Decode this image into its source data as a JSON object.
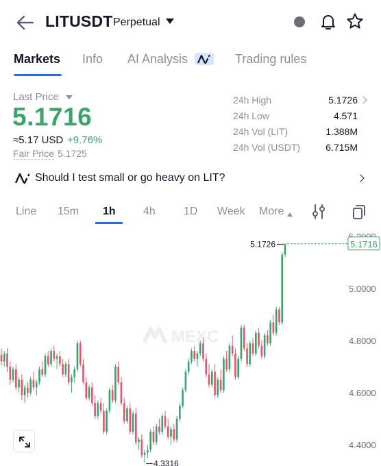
{
  "header": {
    "back_icon": "arrow-left-icon",
    "symbol": "LITUSDT",
    "contract_type": "Perpetual",
    "icons": [
      "status-dot-icon",
      "bell-icon",
      "star-icon"
    ]
  },
  "tabs": [
    {
      "label": "Markets",
      "active": true
    },
    {
      "label": "Info",
      "active": false
    },
    {
      "label": "AI Analysis",
      "active": false
    },
    {
      "label": "Trading rules",
      "active": false
    }
  ],
  "price": {
    "last_price_label": "Last Price",
    "last_price": "5.1716",
    "usd_value": "≈5.17 USD",
    "change": "+9.76%",
    "fair_price_label": "Fair Price",
    "fair_price": "5.1725"
  },
  "stats": [
    {
      "label": "24h High",
      "value": "5.1726"
    },
    {
      "label": "24h Low",
      "value": "4.571"
    },
    {
      "label": "24h Vol (LIT)",
      "value": "1.388M"
    },
    {
      "label": "24h Vol (USDT)",
      "value": "6.715M"
    }
  ],
  "ai_prompt": {
    "text": "Should I test small or go heavy on LIT?"
  },
  "intervals": [
    {
      "label": "Line",
      "active": false
    },
    {
      "label": "15m",
      "active": false
    },
    {
      "label": "1h",
      "active": true
    },
    {
      "label": "4h",
      "active": false
    },
    {
      "label": "1D",
      "active": false
    },
    {
      "label": "Week",
      "active": false
    },
    {
      "label": "More",
      "active": false
    }
  ],
  "colors": {
    "up": "#3aa56a",
    "down": "#e5566e",
    "accent": "#1f6fe0"
  },
  "chart_data": {
    "type": "candlestick",
    "y_ticks": [
      "5.2000",
      "5.0000",
      "4.8000",
      "4.6000",
      "4.4000"
    ],
    "ylim": [
      4.3,
      5.2
    ],
    "high_marker": "5.1726",
    "low_marker": "4.3316",
    "current_price_label": "5.1716",
    "watermark": "MEXC",
    "candles": [
      [
        4.745,
        4.77,
        4.705,
        4.72
      ],
      [
        4.72,
        4.76,
        4.7,
        4.75
      ],
      [
        4.75,
        4.77,
        4.68,
        4.7
      ],
      [
        4.7,
        4.72,
        4.63,
        4.65
      ],
      [
        4.65,
        4.7,
        4.64,
        4.69
      ],
      [
        4.69,
        4.71,
        4.61,
        4.62
      ],
      [
        4.62,
        4.66,
        4.6,
        4.65
      ],
      [
        4.65,
        4.67,
        4.57,
        4.59
      ],
      [
        4.59,
        4.63,
        4.56,
        4.62
      ],
      [
        4.62,
        4.64,
        4.58,
        4.6
      ],
      [
        4.6,
        4.66,
        4.59,
        4.65
      ],
      [
        4.65,
        4.68,
        4.61,
        4.62
      ],
      [
        4.62,
        4.65,
        4.59,
        4.64
      ],
      [
        4.64,
        4.7,
        4.63,
        4.69
      ],
      [
        4.69,
        4.72,
        4.66,
        4.67
      ],
      [
        4.67,
        4.75,
        4.66,
        4.74
      ],
      [
        4.74,
        4.76,
        4.7,
        4.71
      ],
      [
        4.71,
        4.77,
        4.7,
        4.76
      ],
      [
        4.76,
        4.78,
        4.72,
        4.73
      ],
      [
        4.73,
        4.75,
        4.69,
        4.74
      ],
      [
        4.74,
        4.76,
        4.7,
        4.71
      ],
      [
        4.71,
        4.73,
        4.66,
        4.67
      ],
      [
        4.67,
        4.72,
        4.66,
        4.71
      ],
      [
        4.71,
        4.73,
        4.63,
        4.64
      ],
      [
        4.64,
        4.67,
        4.6,
        4.66
      ],
      [
        4.66,
        4.7,
        4.64,
        4.69
      ],
      [
        4.69,
        4.8,
        4.68,
        4.79
      ],
      [
        4.79,
        4.8,
        4.7,
        4.71
      ],
      [
        4.71,
        4.73,
        4.63,
        4.64
      ],
      [
        4.64,
        4.66,
        4.57,
        4.58
      ],
      [
        4.58,
        4.63,
        4.57,
        4.62
      ],
      [
        4.62,
        4.64,
        4.55,
        4.56
      ],
      [
        4.56,
        4.59,
        4.5,
        4.51
      ],
      [
        4.51,
        4.57,
        4.5,
        4.56
      ],
      [
        4.56,
        4.58,
        4.52,
        4.53
      ],
      [
        4.53,
        4.56,
        4.44,
        4.45
      ],
      [
        4.45,
        4.54,
        4.44,
        4.53
      ],
      [
        4.53,
        4.62,
        4.52,
        4.61
      ],
      [
        4.61,
        4.63,
        4.56,
        4.57
      ],
      [
        4.57,
        4.71,
        4.56,
        4.7
      ],
      [
        4.7,
        4.72,
        4.63,
        4.64
      ],
      [
        4.64,
        4.66,
        4.55,
        4.56
      ],
      [
        4.56,
        4.58,
        4.48,
        4.49
      ],
      [
        4.49,
        4.55,
        4.48,
        4.54
      ],
      [
        4.54,
        4.56,
        4.44,
        4.45
      ],
      [
        4.45,
        4.53,
        4.44,
        4.52
      ],
      [
        4.52,
        4.54,
        4.4,
        4.41
      ],
      [
        4.41,
        4.43,
        4.38,
        4.42
      ],
      [
        4.42,
        4.44,
        4.35,
        4.36
      ],
      [
        4.36,
        4.38,
        4.33,
        4.37
      ],
      [
        4.37,
        4.4,
        4.35,
        4.38
      ],
      [
        4.38,
        4.46,
        4.37,
        4.45
      ],
      [
        4.45,
        4.47,
        4.4,
        4.41
      ],
      [
        4.41,
        4.48,
        4.4,
        4.47
      ],
      [
        4.47,
        4.5,
        4.44,
        4.45
      ],
      [
        4.45,
        4.52,
        4.44,
        4.51
      ],
      [
        4.51,
        4.53,
        4.46,
        4.47
      ],
      [
        4.47,
        4.5,
        4.42,
        4.43
      ],
      [
        4.43,
        4.47,
        4.4,
        4.46
      ],
      [
        4.46,
        4.48,
        4.41,
        4.42
      ],
      [
        4.42,
        4.51,
        4.41,
        4.5
      ],
      [
        4.5,
        4.56,
        4.49,
        4.55
      ],
      [
        4.55,
        4.62,
        4.54,
        4.61
      ],
      [
        4.61,
        4.69,
        4.6,
        4.68
      ],
      [
        4.68,
        4.73,
        4.67,
        4.72
      ],
      [
        4.72,
        4.77,
        4.71,
        4.76
      ],
      [
        4.76,
        4.78,
        4.72,
        4.73
      ],
      [
        4.73,
        4.76,
        4.7,
        4.75
      ],
      [
        4.75,
        4.8,
        4.74,
        4.79
      ],
      [
        4.79,
        4.81,
        4.72,
        4.73
      ],
      [
        4.73,
        4.75,
        4.66,
        4.67
      ],
      [
        4.67,
        4.71,
        4.62,
        4.63
      ],
      [
        4.63,
        4.69,
        4.62,
        4.68
      ],
      [
        4.68,
        4.71,
        4.58,
        4.59
      ],
      [
        4.59,
        4.66,
        4.58,
        4.65
      ],
      [
        4.65,
        4.69,
        4.6,
        4.61
      ],
      [
        4.61,
        4.74,
        4.6,
        4.73
      ],
      [
        4.73,
        4.76,
        4.68,
        4.69
      ],
      [
        4.69,
        4.79,
        4.68,
        4.78
      ],
      [
        4.78,
        4.82,
        4.74,
        4.75
      ],
      [
        4.75,
        4.77,
        4.65,
        4.66
      ],
      [
        4.66,
        4.74,
        4.65,
        4.73
      ],
      [
        4.73,
        4.86,
        4.72,
        4.85
      ],
      [
        4.85,
        4.86,
        4.76,
        4.77
      ],
      [
        4.77,
        4.79,
        4.7,
        4.71
      ],
      [
        4.71,
        4.8,
        4.7,
        4.79
      ],
      [
        4.79,
        4.81,
        4.74,
        4.75
      ],
      [
        4.75,
        4.84,
        4.74,
        4.83
      ],
      [
        4.83,
        4.85,
        4.77,
        4.78
      ],
      [
        4.78,
        4.8,
        4.73,
        4.74
      ],
      [
        4.74,
        4.83,
        4.73,
        4.82
      ],
      [
        4.82,
        4.84,
        4.78,
        4.79
      ],
      [
        4.79,
        4.88,
        4.78,
        4.87
      ],
      [
        4.87,
        4.9,
        4.82,
        4.83
      ],
      [
        4.83,
        4.93,
        4.82,
        4.92
      ],
      [
        4.92,
        4.93,
        4.86,
        4.87
      ],
      [
        4.87,
        5.14,
        4.86,
        5.13
      ],
      [
        5.13,
        5.1726,
        5.12,
        5.1716
      ]
    ]
  }
}
